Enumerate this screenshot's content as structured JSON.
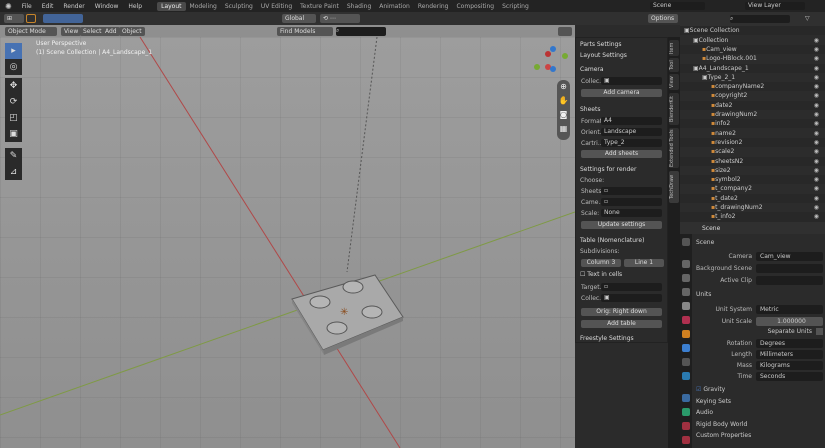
{
  "menu": {
    "items": [
      "File",
      "Edit",
      "Render",
      "Window",
      "Help"
    ]
  },
  "workspaces": [
    "Layout",
    "Modeling",
    "Sculpting",
    "UV Editing",
    "Texture Paint",
    "Shading",
    "Animation",
    "Rendering",
    "Compositing",
    "Scripting"
  ],
  "scene": {
    "scene_name": "Scene",
    "view_layer": "View Layer",
    "options": "Options"
  },
  "viewport_header": {
    "mode": "Object Mode",
    "menus": [
      "View",
      "Select",
      "Add",
      "Object"
    ],
    "transform": "Global",
    "search_value": "Find Models"
  },
  "viewport": {
    "perspective": "User Perspective",
    "collection": "(1) Scene Collection | A4_Landscape_1"
  },
  "npanel": {
    "tabs": [
      "Item",
      "Tool",
      "View",
      "BlenderKit",
      "Extended Tools",
      "TechDraw"
    ],
    "parts_settings": "Parts Settings",
    "layout_settings": "Layout Settings",
    "camera": "Camera",
    "collection_label": "Collec...",
    "add_camera": "Add camera",
    "sheets": "Sheets",
    "format_label": "Format:",
    "format": "A4",
    "orient_label": "Orient...",
    "orient": "Landscape",
    "cartridge_label": "Cartri...",
    "cartridge": "Type_2",
    "add_sheets": "Add sheets",
    "render_settings": "Settings for render",
    "choose": "Choose:",
    "sheets_label": "Sheets:",
    "camera_label": "Came...",
    "scale_label": "Scale:",
    "scale": "None",
    "update": "Update settings",
    "table": "Table (Nomenclature)",
    "subdivisions": "Subdivisions:",
    "column_label": "Column",
    "column": "3",
    "line_label": "Line",
    "line": "1",
    "text_in_cells": "Text in cells",
    "target_label": "Target...",
    "collec2_label": "Collec...",
    "orig": "Orig: Right down",
    "add_table": "Add table",
    "freestyle": "Freestyle Settings"
  },
  "outliner": {
    "items": [
      {
        "label": "Scene Collection",
        "level": 0
      },
      {
        "label": "Collection",
        "level": 1
      },
      {
        "label": "Cam_view",
        "level": 2
      },
      {
        "label": "Logo-HBlock.001",
        "level": 2
      },
      {
        "label": "A4_Landscape_1",
        "level": 1
      },
      {
        "label": "Type_2_1",
        "level": 2
      },
      {
        "label": "companyName2",
        "level": 3
      },
      {
        "label": "copyright2",
        "level": 3
      },
      {
        "label": "date2",
        "level": 3
      },
      {
        "label": "drawingNum2",
        "level": 3
      },
      {
        "label": "info2",
        "level": 3
      },
      {
        "label": "name2",
        "level": 3
      },
      {
        "label": "revision2",
        "level": 3
      },
      {
        "label": "scale2",
        "level": 3
      },
      {
        "label": "sheetsN2",
        "level": 3
      },
      {
        "label": "size2",
        "level": 3
      },
      {
        "label": "symbol2",
        "level": 3
      },
      {
        "label": "t_company2",
        "level": 3
      },
      {
        "label": "t_date2",
        "level": 3
      },
      {
        "label": "t_drawingNum2",
        "level": 3
      },
      {
        "label": "t_info2",
        "level": 3
      }
    ]
  },
  "properties": {
    "header": "Scene",
    "section": "Scene",
    "camera_label": "Camera",
    "camera": "Cam_view",
    "bg_label": "Background Scene",
    "clip_label": "Active Clip",
    "units": "Units",
    "unit_system_label": "Unit System",
    "unit_system": "Metric",
    "unit_scale_label": "Unit Scale",
    "unit_scale": "1.000000",
    "separate_units": "Separate Units",
    "rotation_label": "Rotation",
    "rotation": "Degrees",
    "length_label": "Length",
    "length": "Millimeters",
    "mass_label": "Mass",
    "mass": "Kilograms",
    "time_label": "Time",
    "time": "Seconds",
    "gravity": "Gravity",
    "keying_sets": "Keying Sets",
    "audio": "Audio",
    "rigid_body": "Rigid Body World",
    "custom_props": "Custom Properties"
  },
  "colors": {
    "accent": "#4772b3",
    "x_axis": "#9a3b3b",
    "y_axis": "#6b8a3a"
  }
}
